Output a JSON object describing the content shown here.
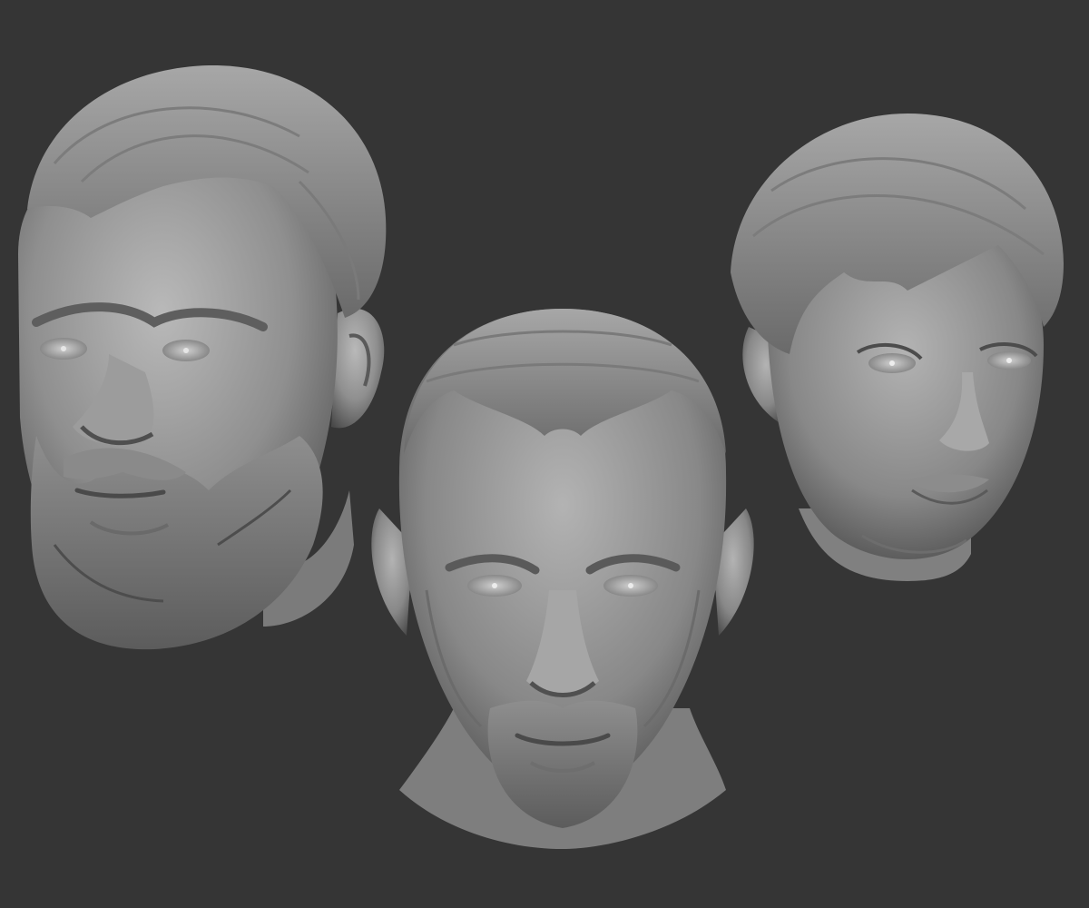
{
  "viewport": {
    "background": "#353535"
  },
  "models": [
    {
      "name": "bearded-man-head",
      "material_color": "#9a9a9a"
    },
    {
      "name": "goateed-man-head",
      "material_color": "#9a9a9a"
    },
    {
      "name": "short-haired-woman-head",
      "material_color": "#9a9a9a"
    }
  ]
}
